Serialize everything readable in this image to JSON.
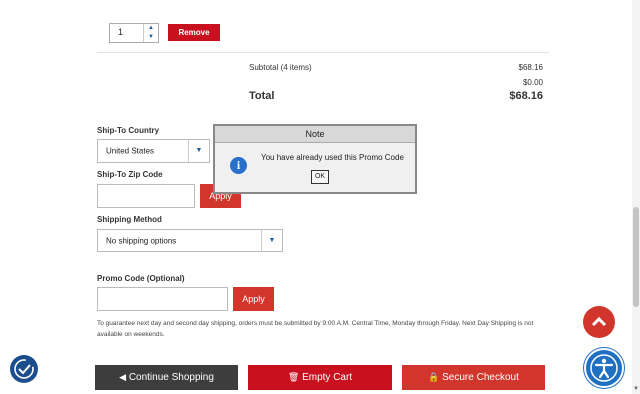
{
  "cart_item": {
    "quantity": "1",
    "remove_label": "Remove"
  },
  "summary": {
    "subtotal_label": "Subtotal (4 items)",
    "subtotal_value": "$68.16",
    "extra_value": "$0.00",
    "total_label": "Total",
    "total_value": "$68.16"
  },
  "shipping": {
    "country_label": "Ship-To Country",
    "country_value": "United States",
    "zip_label": "Ship-To Zip Code",
    "zip_value": "",
    "apply_label": "Apply",
    "method_label": "Shipping Method",
    "method_value": "No shipping options"
  },
  "promo": {
    "label": "Promo Code (Optional)",
    "value": "",
    "apply_label": "Apply"
  },
  "shipping_note": "To guarantee next day and second day shipping, orders must be submitted by 9:00 A.M. Central Time, Monday through Friday. Next Day Shipping is not available on weekends.",
  "actions": {
    "continue_label": "Continue Shopping",
    "empty_label": "Empty Cart",
    "checkout_label": "Secure Checkout"
  },
  "dialog": {
    "title": "Note",
    "message": "You have already used this Promo Code",
    "ok_label": "OK"
  },
  "colors": {
    "accent_red": "#d2352b",
    "remove_red": "#c8101e",
    "dark_button": "#3d3d3d",
    "access_blue": "#1f6fc2"
  }
}
